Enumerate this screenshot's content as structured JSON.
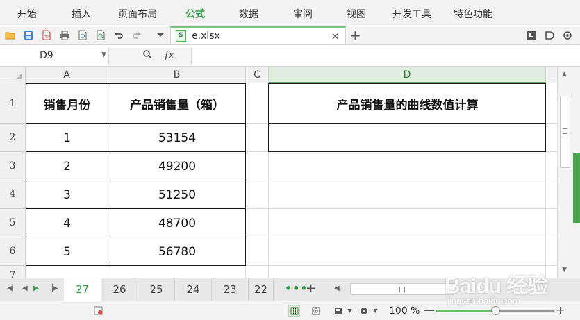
{
  "menu": [
    {
      "label": "开始",
      "active": false
    },
    {
      "label": "插入",
      "active": false
    },
    {
      "label": "页面布局",
      "active": false
    },
    {
      "label": "公式",
      "active": true
    },
    {
      "label": "数据",
      "active": false
    },
    {
      "label": "审阅",
      "active": false
    },
    {
      "label": "视图",
      "active": false
    },
    {
      "label": "开发工具",
      "active": false
    },
    {
      "label": "特色功能",
      "active": false
    }
  ],
  "doc_tab": {
    "icon": "xlsx-file-icon",
    "filename": "e.xlsx",
    "close": "×",
    "add": "+"
  },
  "formula_bar": {
    "cell_ref": "D9",
    "fx": "fx",
    "formula": ""
  },
  "columns": [
    "A",
    "B",
    "C",
    "D"
  ],
  "rows": [
    "1",
    "2",
    "3",
    "4",
    "5",
    "6",
    "7"
  ],
  "table": {
    "headers": [
      "销售月份",
      "产品销售量（箱）"
    ],
    "rows": [
      [
        "1",
        "53154"
      ],
      [
        "2",
        "49200"
      ],
      [
        "3",
        "51250"
      ],
      [
        "4",
        "48700"
      ],
      [
        "5",
        "56780"
      ]
    ]
  },
  "d_header": "产品销售量的曲线数值计算",
  "sheet_tabs": [
    "27",
    "26",
    "25",
    "24",
    "23",
    "22"
  ],
  "active_sheet": "27",
  "tab_more": "•••",
  "tab_add": "+",
  "status": {
    "zoom": "100 %",
    "zoom_minus": "—",
    "zoom_plus": "+",
    "zoom_fraction": 0.5
  },
  "watermark": {
    "line1": "Baidu 经验",
    "line2": "jingyan.baidu.com"
  },
  "colors": {
    "accent": "#2f9e44",
    "tab_green": "#4aa64e"
  }
}
